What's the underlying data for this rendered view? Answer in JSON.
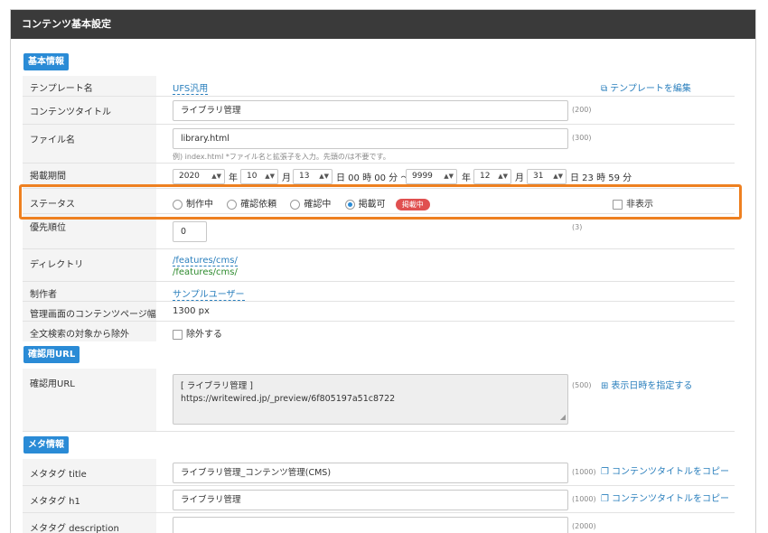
{
  "header": {
    "title": "コンテンツ基本設定"
  },
  "sections": {
    "basic": "基本情報",
    "preview": "確認用URL",
    "meta": "メタ情報"
  },
  "template": {
    "label": "テンプレート名",
    "value": "UFS汎用",
    "edit_link": "テンプレートを編集"
  },
  "content_title": {
    "label": "コンテンツタイトル",
    "value": "ライブラリ管理",
    "limit": "(200)"
  },
  "file_name": {
    "label": "ファイル名",
    "value": "library.html",
    "limit": "(300)",
    "hint": "例) index.html *ファイル名と拡張子を入力。先頭の/は不要です。"
  },
  "period": {
    "label": "掲載期間",
    "start_year": "2020",
    "start_month": "10",
    "start_day": "13",
    "year_suffix": "年",
    "month_suffix": "月",
    "start_time": "日 00 時 00 分 〜",
    "end_year": "9999",
    "end_month": "12",
    "end_day": "31",
    "end_time": "日 23 時 59 分"
  },
  "status": {
    "label": "ステータス",
    "options": [
      "制作中",
      "確認依頼",
      "確認中",
      "掲載可"
    ],
    "selected": "掲載可",
    "badge": "掲載中",
    "hidden_label": "非表示",
    "badge_color": "#e05050",
    "highlight_color": "#ee8020"
  },
  "priority": {
    "label": "優先順位",
    "value": "0",
    "limit": "(3)"
  },
  "directory": {
    "label": "ディレクトリ",
    "link1": "/features/cms/",
    "link2": "/features/cms/"
  },
  "author": {
    "label": "制作者",
    "value": "サンプルユーザー"
  },
  "width": {
    "label": "管理画面のコンテンツページ幅",
    "value": "1300 px"
  },
  "fulltext": {
    "label": "全文検索の対象から除外",
    "option": "除外する"
  },
  "preview_url": {
    "label": "確認用URL",
    "line1": "[ ライブラリ管理 ]",
    "line2": "https://writewired.jp/_preview/6f805197a51c8722",
    "limit": "(500)",
    "date_link": "表示日時を指定する"
  },
  "meta_title": {
    "label": "メタタグ title",
    "value": "ライブラリ管理_コンテンツ管理(CMS)",
    "limit": "(1000)",
    "copy_link": "コンテンツタイトルをコピー"
  },
  "meta_h1": {
    "label": "メタタグ h1",
    "value": "ライブラリ管理",
    "limit": "(1000)",
    "copy_link": "コンテンツタイトルをコピー"
  },
  "meta_desc": {
    "label": "メタタグ description",
    "limit": "(2000)"
  },
  "accent_color": "#2a8bd6"
}
